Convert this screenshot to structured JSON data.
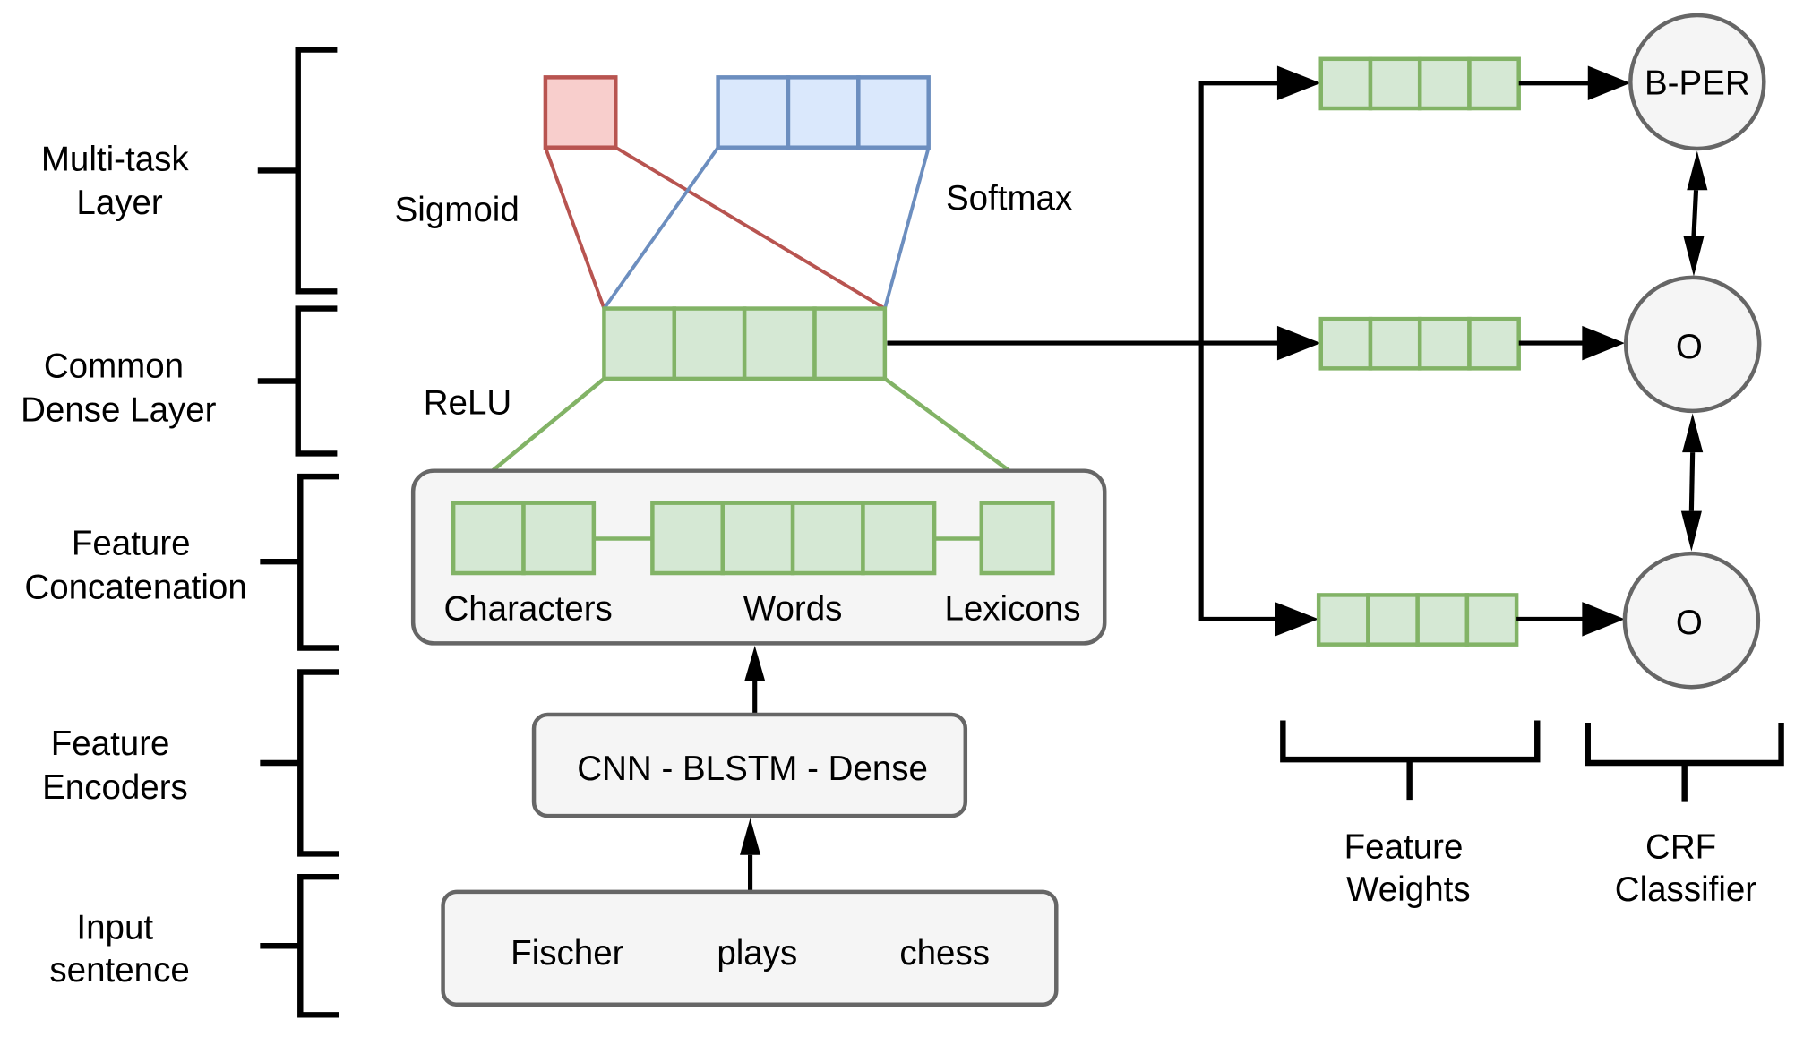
{
  "layers": [
    {
      "line1": "Multi-task",
      "line2": "Layer"
    },
    {
      "line1": "Common",
      "line2": "Dense Layer"
    },
    {
      "line1": "Feature",
      "line2": "Concatenation"
    },
    {
      "line1": "Feature",
      "line2": "Encoders"
    },
    {
      "line1": "Input",
      "line2": "sentence"
    }
  ],
  "activations": {
    "sigmoid": "Sigmoid",
    "softmax": "Softmax",
    "relu": "ReLU"
  },
  "concatenation": {
    "characters": "Characters",
    "words": "Words",
    "lexicons": "Lexicons"
  },
  "encoder": {
    "label": "CNN - BLSTM - Dense"
  },
  "input": {
    "words": [
      "Fischer",
      "plays",
      "chess"
    ]
  },
  "crf": {
    "tags": [
      "B-PER",
      "O",
      "O"
    ]
  },
  "bottom_labels": {
    "feature_weights": {
      "line1": "Feature",
      "line2": "Weights"
    },
    "crf_classifier": {
      "line1": "CRF",
      "line2": "Classifier"
    }
  },
  "colors": {
    "green_fill": "#d5e8d4",
    "green_stroke": "#82b366",
    "red_fill": "#f8cecc",
    "red_stroke": "#b85450",
    "blue_fill": "#dae8fc",
    "blue_stroke": "#6c8ebf",
    "box_fill": "#f5f5f5",
    "box_stroke": "#666666"
  }
}
